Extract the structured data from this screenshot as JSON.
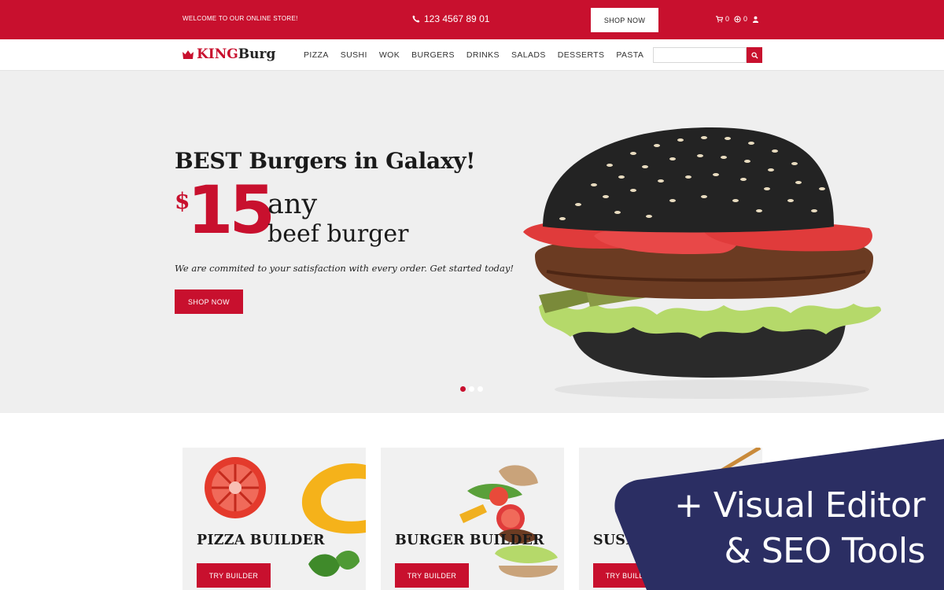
{
  "topbar": {
    "welcome": "WELCOME TO OUR ONLINE STORE!",
    "phone": "123 4567 89 01",
    "shop_now": "SHOP NOW",
    "cart_count": "0",
    "compare_count": "0",
    "phone_icon": "phone-icon",
    "cart_icon": "cart-icon",
    "compare_icon": "compare-icon",
    "user_icon": "user-icon"
  },
  "nav": {
    "logo_king": "KING",
    "logo_burg": "Burg",
    "items": [
      "PIZZA",
      "SUSHI",
      "WOK",
      "BURGERS",
      "DRINKS",
      "SALADS",
      "DESSERTS",
      "PASTA"
    ],
    "search_placeholder": ""
  },
  "hero": {
    "title": "BEST Burgers in Galaxy!",
    "currency": "$",
    "price": "15",
    "offer_line1": "any",
    "offer_line2": "beef burger",
    "tagline": "We are commited to your satisfaction with every order. Get started today!",
    "cta": "SHOP NOW",
    "slides": 3,
    "active_slide": 1
  },
  "cards": [
    {
      "title": "PIZZA BUILDER",
      "button": "TRY BUILDER"
    },
    {
      "title": "BURGER BUILDER",
      "button": "TRY BUILDER"
    },
    {
      "title": "SUSHI BUILDER",
      "button": "TRY BUILDER"
    }
  ],
  "promo": {
    "line1": "+ Visual Editor",
    "line2": "& SEO Tools"
  },
  "colors": {
    "brand_red": "#c8102e",
    "promo_navy": "#2b2e63",
    "hero_bg": "#efefef"
  }
}
